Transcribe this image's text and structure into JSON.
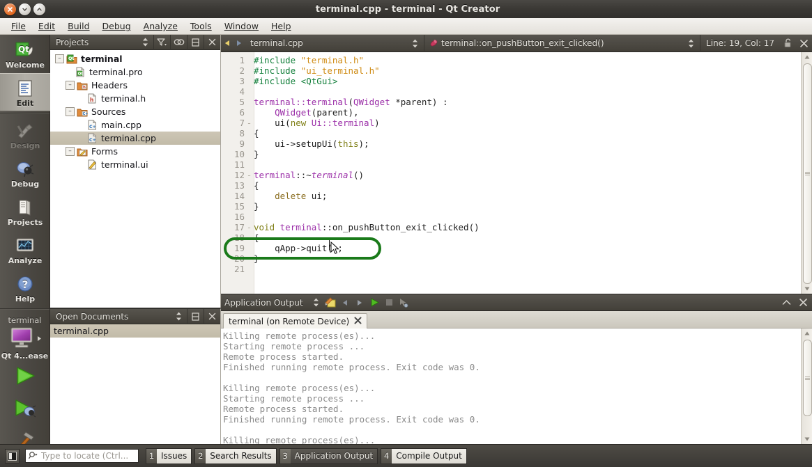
{
  "window": {
    "title": "terminal.cpp - terminal - Qt Creator",
    "buttons": {
      "close": "×",
      "minimize": "⌄",
      "maximize": "⌃"
    }
  },
  "menubar": {
    "items": [
      {
        "label": "File"
      },
      {
        "label": "Edit"
      },
      {
        "label": "Build"
      },
      {
        "label": "Debug"
      },
      {
        "label": "Analyze"
      },
      {
        "label": "Tools"
      },
      {
        "label": "Window"
      },
      {
        "label": "Help"
      }
    ]
  },
  "modebar": {
    "modes": [
      {
        "label": "Welcome",
        "icon": "qt-logo-icon",
        "state": "normal"
      },
      {
        "label": "Edit",
        "icon": "edit-document-icon",
        "state": "active"
      },
      {
        "label": "Design",
        "icon": "design-tools-icon",
        "state": "disabled"
      },
      {
        "label": "Debug",
        "icon": "bug-icon",
        "state": "normal"
      },
      {
        "label": "Projects",
        "icon": "folder-books-icon",
        "state": "normal"
      },
      {
        "label": "Analyze",
        "icon": "monitor-graph-icon",
        "state": "normal"
      },
      {
        "label": "Help",
        "icon": "question-mark-icon",
        "state": "normal"
      }
    ],
    "kit": {
      "project_name": "terminal",
      "target_label": "Qt 4...ease",
      "target_icon": "remote-device-monitor-icon",
      "run_icon": "run-green-triangle-icon",
      "debug_icon": "run-debug-icon",
      "build_icon": "hammer-build-icon"
    }
  },
  "projects_panel": {
    "title": "Projects",
    "header_icons": [
      "sort-updown-icon",
      "filter-icon",
      "link-sync-icon",
      "split-icon",
      "close-icon"
    ],
    "tree": [
      {
        "label": "terminal",
        "indent": 0,
        "expander": "-",
        "icon": "qt-project-icon",
        "bold": true,
        "selected": false
      },
      {
        "label": "terminal.pro",
        "indent": 1,
        "expander": "",
        "icon": "qt-pro-file-icon",
        "bold": false,
        "selected": false
      },
      {
        "label": "Headers",
        "indent": 1,
        "expander": "-",
        "icon": "headers-folder-icon",
        "bold": false,
        "selected": false
      },
      {
        "label": "terminal.h",
        "indent": 2,
        "expander": "",
        "icon": "h-file-icon",
        "bold": false,
        "selected": false
      },
      {
        "label": "Sources",
        "indent": 1,
        "expander": "-",
        "icon": "sources-folder-icon",
        "bold": false,
        "selected": false
      },
      {
        "label": "main.cpp",
        "indent": 2,
        "expander": "",
        "icon": "cpp-file-icon",
        "bold": false,
        "selected": false
      },
      {
        "label": "terminal.cpp",
        "indent": 2,
        "expander": "",
        "icon": "cpp-file-icon",
        "bold": false,
        "selected": true
      },
      {
        "label": "Forms",
        "indent": 1,
        "expander": "-",
        "icon": "forms-folder-icon",
        "bold": false,
        "selected": false
      },
      {
        "label": "terminal.ui",
        "indent": 2,
        "expander": "",
        "icon": "ui-file-icon",
        "bold": false,
        "selected": false
      }
    ]
  },
  "open_documents": {
    "title": "Open Documents",
    "header_icons": [
      "sort-updown-icon",
      "split-icon",
      "close-icon"
    ],
    "items": [
      {
        "label": "terminal.cpp",
        "selected": true
      }
    ]
  },
  "editor": {
    "toolbar": {
      "nav_back_icon": "nav-back-icon",
      "nav_forward_icon": "nav-forward-icon",
      "file_combo": "terminal.cpp",
      "symbol_combo": "terminal::on_pushButton_exit_clicked()",
      "symbol_icon": "method-symbol-icon",
      "cursor_position": "Line: 19, Col: 17",
      "lock_icon": "unlocked-padlock-icon",
      "close_icon": "close-icon"
    },
    "lines": [
      {
        "n": "1",
        "fold": "",
        "tokens": [
          {
            "t": "#include ",
            "c": "prep"
          },
          {
            "t": "\"terminal.h\"",
            "c": "str"
          }
        ]
      },
      {
        "n": "2",
        "fold": "",
        "tokens": [
          {
            "t": "#include ",
            "c": "prep"
          },
          {
            "t": "\"ui_terminal.h\"",
            "c": "str"
          }
        ]
      },
      {
        "n": "3",
        "fold": "",
        "tokens": [
          {
            "t": "#include ",
            "c": "prep"
          },
          {
            "t": "<QtGui>",
            "c": "prep"
          }
        ]
      },
      {
        "n": "4",
        "fold": "",
        "tokens": []
      },
      {
        "n": "5",
        "fold": "",
        "tokens": [
          {
            "t": "terminal::terminal",
            "c": "typ"
          },
          {
            "t": "(",
            "c": "fn"
          },
          {
            "t": "QWidget",
            "c": "typ"
          },
          {
            "t": " *parent) :",
            "c": "fn"
          }
        ]
      },
      {
        "n": "6",
        "fold": "",
        "tokens": [
          {
            "t": "    ",
            "c": "fn"
          },
          {
            "t": "QWidget",
            "c": "typ"
          },
          {
            "t": "(parent),",
            "c": "fn"
          }
        ]
      },
      {
        "n": "7",
        "fold": "-",
        "tokens": [
          {
            "t": "    ui(",
            "c": "fn"
          },
          {
            "t": "new",
            "c": "kw"
          },
          {
            "t": " ",
            "c": "fn"
          },
          {
            "t": "Ui::terminal",
            "c": "typ"
          },
          {
            "t": ")",
            "c": "fn"
          }
        ]
      },
      {
        "n": "8",
        "fold": "",
        "tokens": [
          {
            "t": "{",
            "c": "fn"
          }
        ]
      },
      {
        "n": "9",
        "fold": "",
        "tokens": [
          {
            "t": "    ui->setupUi(",
            "c": "fn"
          },
          {
            "t": "this",
            "c": "kw"
          },
          {
            "t": ");",
            "c": "fn"
          }
        ]
      },
      {
        "n": "10",
        "fold": "",
        "tokens": [
          {
            "t": "}",
            "c": "fn"
          }
        ]
      },
      {
        "n": "11",
        "fold": "",
        "tokens": []
      },
      {
        "n": "12",
        "fold": "-",
        "tokens": [
          {
            "t": "terminal",
            "c": "typ"
          },
          {
            "t": "::~",
            "c": "fn"
          },
          {
            "t": "terminal",
            "c": "typ ital"
          },
          {
            "t": "()",
            "c": "fn"
          }
        ]
      },
      {
        "n": "13",
        "fold": "",
        "tokens": [
          {
            "t": "{",
            "c": "fn"
          }
        ]
      },
      {
        "n": "14",
        "fold": "",
        "tokens": [
          {
            "t": "    ",
            "c": "fn"
          },
          {
            "t": "delete",
            "c": "var"
          },
          {
            "t": " ui;",
            "c": "fn"
          }
        ]
      },
      {
        "n": "15",
        "fold": "",
        "tokens": [
          {
            "t": "}",
            "c": "fn"
          }
        ]
      },
      {
        "n": "16",
        "fold": "",
        "tokens": []
      },
      {
        "n": "17",
        "fold": "-",
        "tokens": [
          {
            "t": "void",
            "c": "kw"
          },
          {
            "t": " ",
            "c": "fn"
          },
          {
            "t": "terminal",
            "c": "typ"
          },
          {
            "t": "::on_pushButton_exit_clicked()",
            "c": "fn"
          }
        ]
      },
      {
        "n": "18",
        "fold": "",
        "tokens": [
          {
            "t": "{",
            "c": "fn"
          }
        ]
      },
      {
        "n": "19",
        "fold": "",
        "tokens": [
          {
            "t": "    qApp->quit();",
            "c": "fn"
          }
        ],
        "current": true
      },
      {
        "n": "20",
        "fold": "",
        "tokens": [
          {
            "t": "}",
            "c": "fn"
          }
        ]
      },
      {
        "n": "21",
        "fold": "",
        "tokens": []
      }
    ]
  },
  "output_panel": {
    "title": "Application Output",
    "toolbar_icons": [
      "sort-updown-icon",
      "clear-output-icon",
      "prev-item-icon",
      "next-item-icon",
      "run-icon",
      "stop-icon",
      "attach-icon"
    ],
    "maximize_icon": "chevron-up-icon",
    "close_icon": "close-icon",
    "tabs": [
      {
        "label": "terminal (on Remote Device)",
        "close_icon": "close-tab-icon",
        "active": true
      }
    ],
    "text": "Killing remote process(es)...\nStarting remote process ...\nRemote process started.\nFinished running remote process. Exit code was 0.\n\nKilling remote process(es)...\nStarting remote process ...\nRemote process started.\nFinished running remote process. Exit code was 0.\n\nKilling remote process(es)..."
  },
  "statusbar": {
    "sidebar_toggle_icon": "sidebar-toggle-icon",
    "locator": {
      "icon": "search-icon",
      "placeholder": "Type to locate (Ctrl..."
    },
    "buttons": [
      {
        "number": "1",
        "label": "Issues",
        "active": true
      },
      {
        "number": "2",
        "label": "Search Results",
        "active": true
      },
      {
        "number": "3",
        "label": "Application Output",
        "active": false
      },
      {
        "number": "4",
        "label": "Compile Output",
        "active": true
      }
    ]
  },
  "annotation": {
    "shape": "green-ellipse-highlight",
    "color": "#1a7a1a",
    "target_line": "19"
  },
  "colors": {
    "accent_green": "#1a7a1a",
    "preprocessor": "#14803c",
    "string": "#cf8b13",
    "type": "#9b2fa8",
    "keyword": "#7f7f16",
    "selection": "#c8c1af"
  }
}
